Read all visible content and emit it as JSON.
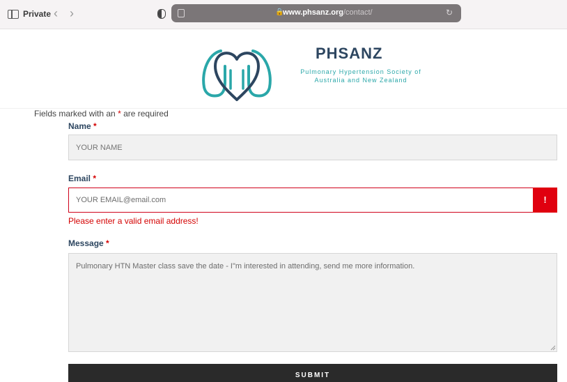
{
  "browser": {
    "private_label": "Private",
    "back_icon": "chevron-left-icon",
    "forward_icon": "chevron-right-icon",
    "url_domain": "www.phsanz.org",
    "url_path": "/contact/"
  },
  "header": {
    "brand_name": "PHSANZ",
    "brand_tagline_line1": "Pulmonary Hypertension Society of",
    "brand_tagline_line2": "Australia and New Zealand",
    "logo_colors": {
      "navy": "#2d4660",
      "teal": "#2aa7a9"
    }
  },
  "form": {
    "required_note_prefix": "Fields marked with an",
    "required_note_star": "*",
    "required_note_suffix": "are required",
    "name_label": "Name",
    "name_placeholder": "YOUR NAME",
    "email_label": "Email",
    "email_value": "YOUR EMAIL@email.com",
    "email_error_badge": "!",
    "email_error_message": "Please enter a valid email address!",
    "message_label": "Message",
    "message_value": "Pulmonary HTN Master class save the date - I\"m interested in attending, send me more information.",
    "submit_label": "SUBMIT",
    "required_star": "*",
    "error_color": "#d40000"
  }
}
